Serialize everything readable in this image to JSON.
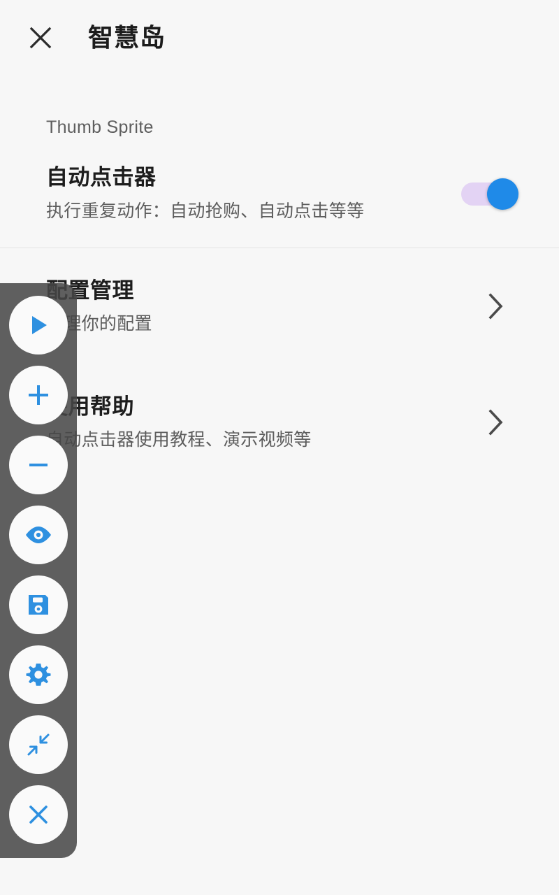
{
  "appbar": {
    "close_icon": "close-icon",
    "title": "智慧岛"
  },
  "section": {
    "caption": "Thumb Sprite"
  },
  "colors": {
    "page_background": "#f7f7f7",
    "title_text": "#1d1d1d",
    "secondary_text": "#5c5c5c",
    "accent_blue": "#1f8ae8",
    "switch_track": "#e3d3f4",
    "divider": "#e4e4e4",
    "toolbar_panel": "#464646",
    "fab_background": "#fafafa"
  },
  "settings": {
    "auto_clicker": {
      "title": "自动点击器",
      "subtitle": "执行重复动作：自动抢购、自动点击等等",
      "switch_state": "on",
      "switch_name": "auto-clicker-toggle"
    }
  },
  "list": [
    {
      "title": "配置管理",
      "subtitle": "管理你的配置",
      "chevron_icon": "chevron-right-icon",
      "name": "config-management"
    },
    {
      "title": "使用帮助",
      "subtitle": "自动点击器使用教程、演示视频等",
      "chevron_icon": "chevron-right-icon",
      "name": "help"
    }
  ],
  "floating_toolbar": {
    "buttons": [
      {
        "icon": "play-icon",
        "name": "play-button"
      },
      {
        "icon": "plus-icon",
        "name": "add-button"
      },
      {
        "icon": "minus-icon",
        "name": "remove-button"
      },
      {
        "icon": "eye-icon",
        "name": "preview-button"
      },
      {
        "icon": "save-icon",
        "name": "save-button"
      },
      {
        "icon": "gear-icon",
        "name": "settings-button"
      },
      {
        "icon": "collapse-icon",
        "name": "collapse-button"
      },
      {
        "icon": "close-icon",
        "name": "close-toolbar-button"
      }
    ]
  }
}
